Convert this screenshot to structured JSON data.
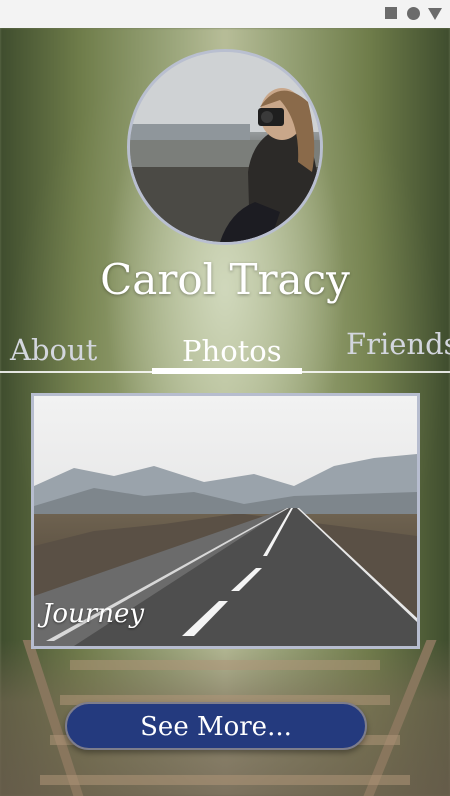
{
  "profile": {
    "name": "Carol Tracy"
  },
  "tabs": [
    {
      "label": "About"
    },
    {
      "label": "Photos"
    },
    {
      "label": "Friends"
    }
  ],
  "active_tab": "Photos",
  "photo": {
    "caption": "Journey"
  },
  "actions": {
    "see_more_label": "See More..."
  },
  "status_bar": {
    "icons": [
      "square-icon",
      "circle-icon",
      "triangle-icon"
    ],
    "color": "#6b6b6b"
  },
  "colors": {
    "button_bg": "#243a7e",
    "card_border": "#b7bdcf",
    "text": "#ffffff"
  }
}
